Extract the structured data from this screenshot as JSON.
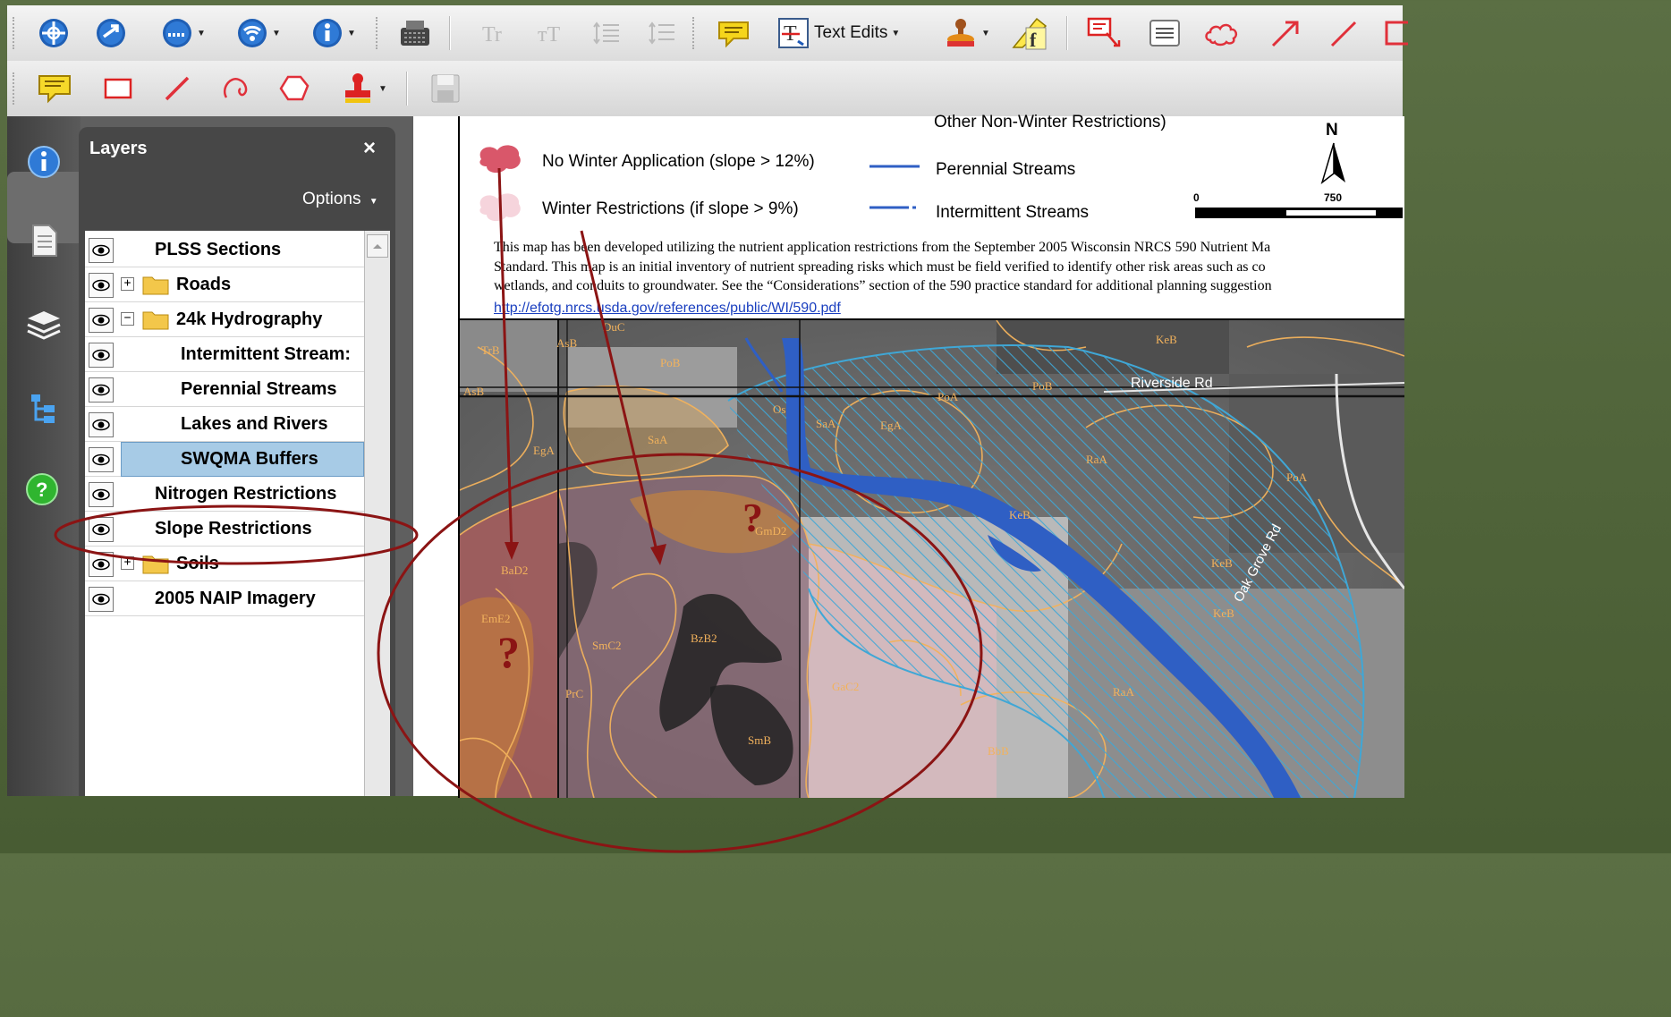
{
  "toolbar": {
    "text_edits_label": "Text Edits"
  },
  "layers_panel": {
    "title": "Layers",
    "close": "×",
    "options": "Options",
    "items": [
      {
        "label": "PLSS Sections"
      },
      {
        "label": "Roads",
        "expander": "+"
      },
      {
        "label": "24k Hydrography",
        "expander": "−"
      },
      {
        "label": "Intermittent Stream:"
      },
      {
        "label": "Perennial Streams"
      },
      {
        "label": "Lakes and Rivers"
      },
      {
        "label": "SWQMA Buffers",
        "selected": true
      },
      {
        "label": "Nitrogen Restrictions"
      },
      {
        "label": "Slope Restrictions"
      },
      {
        "label": "Soils",
        "expander": "+"
      },
      {
        "label": "2005 NAIP Imagery"
      }
    ]
  },
  "map_legend": {
    "top_partial": "Other Non-Winter Restrictions)",
    "no_winter": "No Winter Application (slope > 12%)",
    "winter_restr": "Winter Restrictions (if slope > 9%)",
    "perennial": "Perennial Streams",
    "intermittent": "Intermittent Streams",
    "north": "N",
    "scale_0": "0",
    "scale_750": "750",
    "note_line1": "This map has been developed utilizing the nutrient application restrictions from the September 2005 Wisconsin NRCS 590 Nutrient Ma",
    "note_line2": "Standard. This map is an initial inventory of nutrient spreading risks which must be field verified to identify other risk areas such as co",
    "note_line3": "wetlands, and conduits to groundwater. See the “Considerations” section of the 590 practice standard for additional planning suggestion",
    "link": "http://efotg.nrcs.usda.gov/references/public/WI/590.pdf"
  },
  "map_labels": {
    "riverside_rd": "Riverside Rd",
    "oak_grove_rd": "Oak Grove Rd",
    "soils": [
      "TrB",
      "AsB",
      "PoB",
      "AsB",
      "Os",
      "SaA",
      "EgA",
      "PoA",
      "PoB",
      "KeB",
      "EgA",
      "SaA",
      "RaA",
      "PoA",
      "KeB",
      "BaD2",
      "EmE2",
      "SmC2",
      "BzB2",
      "PrC",
      "SmB",
      "GaC2",
      "RaA",
      "KeB",
      "BbB",
      "GmD2",
      "KeB",
      "DuC"
    ],
    "question": "?"
  },
  "colors": {
    "annotation": "#8b1414",
    "water": "#2f5fc4",
    "buffer": "#3fa7d6",
    "slope_red": "#d9576a",
    "slope_pink": "#f6d4dc"
  }
}
